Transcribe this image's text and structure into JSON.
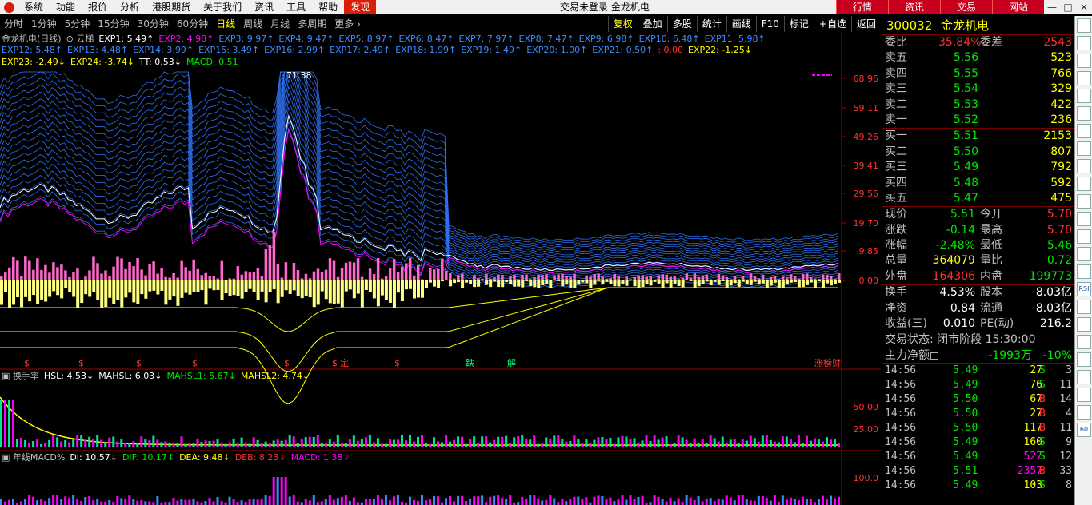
{
  "menubar": {
    "items": [
      "系统",
      "功能",
      "报价",
      "分析",
      "港股期货",
      "关于我们",
      "资讯",
      "工具",
      "帮助",
      "发现"
    ],
    "active_index": 9,
    "center_text": "交易未登录  金龙机电",
    "right_buttons": [
      "行情",
      "资讯",
      "交易",
      "网站"
    ],
    "window_controls": [
      "—",
      "□",
      "✕"
    ]
  },
  "periodbar": {
    "periods": [
      "分时",
      "1分钟",
      "5分钟",
      "15分钟",
      "30分钟",
      "60分钟",
      "日线",
      "周线",
      "月线",
      "多周期",
      "更多 ›"
    ],
    "active_index": 6,
    "right_buttons": [
      "复权",
      "叠加",
      "多股",
      "统计",
      "画线",
      "F10",
      "标记",
      "+自选",
      "返回"
    ],
    "right_highlight_index": 0
  },
  "main_indicator": {
    "name": "金龙机电(日线)",
    "cloud_label": "云梯",
    "items": [
      {
        "t": "EXP1: 5.49↑",
        "c": "#ffffff"
      },
      {
        "t": "EXP2: 4.98↑",
        "c": "#ff00ff"
      },
      {
        "t": "EXP3: 9.97↑",
        "c": "#3e8cff"
      },
      {
        "t": "EXP4: 9.47↑",
        "c": "#3e8cff"
      },
      {
        "t": "EXP5: 8.97↑",
        "c": "#3e8cff"
      },
      {
        "t": "EXP6: 8.47↑",
        "c": "#3e8cff"
      },
      {
        "t": "EXP7: 7.97↑",
        "c": "#3e8cff"
      },
      {
        "t": "EXP8: 7.47↑",
        "c": "#3e8cff"
      },
      {
        "t": "EXP9: 6.98↑",
        "c": "#3e8cff"
      },
      {
        "t": "EXP10: 6.48↑",
        "c": "#3e8cff"
      },
      {
        "t": "EXP11: 5.98↑",
        "c": "#3e8cff"
      }
    ],
    "items_line2": [
      {
        "t": "EXP12: 5.48↑",
        "c": "#3e8cff"
      },
      {
        "t": "EXP13: 4.48↑",
        "c": "#3e8cff"
      },
      {
        "t": "EXP14: 3.99↑",
        "c": "#3e8cff"
      },
      {
        "t": "EXP15: 3.49↑",
        "c": "#3e8cff"
      },
      {
        "t": "EXP16: 2.99↑",
        "c": "#3e8cff"
      },
      {
        "t": "EXP17: 2.49↑",
        "c": "#3e8cff"
      },
      {
        "t": "EXP18: 1.99↑",
        "c": "#3e8cff"
      },
      {
        "t": "EXP19: 1.49↑",
        "c": "#3e8cff"
      },
      {
        "t": "EXP20: 1.00↑",
        "c": "#3e8cff"
      },
      {
        "t": "EXP21: 0.50↑",
        "c": "#3e8cff"
      },
      {
        "t": ": 0.00",
        "c": "#ff3232"
      },
      {
        "t": "EXP22: -1.25↓",
        "c": "#ffff00"
      }
    ],
    "items_line3": [
      {
        "t": "EXP23: -2.49↓",
        "c": "#ffff00"
      },
      {
        "t": "EXP24: -3.74↓",
        "c": "#ffff00"
      },
      {
        "t": "TT: 0.53↓",
        "c": "#ffffff"
      },
      {
        "t": "MACD: 0.51",
        "c": "#00e600"
      }
    ],
    "y_ticks": [
      "68.96",
      "59.11",
      "49.26",
      "39.41",
      "29.56",
      "19.70",
      "9.85",
      "0.00"
    ],
    "peak_label": "71.38",
    "markers": [
      "$",
      "$",
      "$",
      "$",
      "$",
      "$",
      "定",
      "$",
      "跌",
      "解",
      "涨榜财"
    ]
  },
  "turnover_indicator": {
    "name": "换手率",
    "items": [
      {
        "t": "HSL: 4.53↓",
        "c": "#ffffff"
      },
      {
        "t": "MAHSL: 6.03↓",
        "c": "#ffffff"
      },
      {
        "t": "MAHSL1: 5.67↓",
        "c": "#00e600"
      },
      {
        "t": "MAHSL2: 4.74↓",
        "c": "#ffff00"
      }
    ],
    "y_ticks": [
      "50.00",
      "25.00"
    ]
  },
  "macd_indicator": {
    "name": "年线MACD%",
    "items": [
      {
        "t": "DI: 10.57↓",
        "c": "#ffffff"
      },
      {
        "t": "DIF: 10.17↓",
        "c": "#00e600"
      },
      {
        "t": "DEA: 9.48↓",
        "c": "#ffff00"
      },
      {
        "t": "DEB: 8.23↓",
        "c": "#ff3232"
      },
      {
        "t": "MACD: 1.38↓",
        "c": "#ff00ff"
      }
    ],
    "y_ticks": [
      "100.0"
    ]
  },
  "quote": {
    "code": "300032",
    "name": "金龙机电",
    "weibi_label": "委比",
    "weibi": "35.84%",
    "weicha_label": "委差",
    "weicha": "2543",
    "asks": [
      {
        "label": "卖五",
        "price": "5.56",
        "vol": "523"
      },
      {
        "label": "卖四",
        "price": "5.55",
        "vol": "766"
      },
      {
        "label": "卖三",
        "price": "5.54",
        "vol": "329"
      },
      {
        "label": "卖二",
        "price": "5.53",
        "vol": "422"
      },
      {
        "label": "卖一",
        "price": "5.52",
        "vol": "236"
      }
    ],
    "bids": [
      {
        "label": "买一",
        "price": "5.51",
        "vol": "2153"
      },
      {
        "label": "买二",
        "price": "5.50",
        "vol": "807"
      },
      {
        "label": "买三",
        "price": "5.49",
        "vol": "792"
      },
      {
        "label": "买四",
        "price": "5.48",
        "vol": "592"
      },
      {
        "label": "买五",
        "price": "5.47",
        "vol": "475"
      }
    ],
    "stats": [
      {
        "l1": "现价",
        "v1": "5.51",
        "c1": "#00e600",
        "l2": "今开",
        "v2": "5.70",
        "c2": "#ff3232"
      },
      {
        "l1": "涨跌",
        "v1": "-0.14",
        "c1": "#00e600",
        "l2": "最高",
        "v2": "5.70",
        "c2": "#ff3232"
      },
      {
        "l1": "涨幅",
        "v1": "-2.48%",
        "c1": "#00e600",
        "l2": "最低",
        "v2": "5.46",
        "c2": "#00e600"
      },
      {
        "l1": "总量",
        "v1": "364079",
        "c1": "#ffff00",
        "l2": "量比",
        "v2": "0.72",
        "c2": "#00e600"
      },
      {
        "l1": "外盘",
        "v1": "164306",
        "c1": "#ff3232",
        "l2": "内盘",
        "v2": "199773",
        "c2": "#00e600"
      }
    ],
    "info": [
      {
        "l1": "换手",
        "v1": "4.53%",
        "l2": "股本",
        "v2": "8.03亿"
      },
      {
        "l1": "净资",
        "v1": "0.84",
        "l2": "流通",
        "v2": "8.03亿"
      },
      {
        "l1": "收益(三)",
        "v1": "0.010",
        "l2": "PE(动)",
        "v2": "216.2"
      }
    ],
    "trade_status": "交易状态: 闭市阶段 15:30:00",
    "main_flow_label": "主力净额",
    "main_flow_value": "-1993万",
    "main_flow_pct": "-10%",
    "ticks": [
      {
        "t": "14:56",
        "p": "5.49",
        "pc": "#00e600",
        "v": "27",
        "vc": "#ffff00",
        "d": "S",
        "dc": "#00e600",
        "n": "3"
      },
      {
        "t": "14:56",
        "p": "5.49",
        "pc": "#00e600",
        "v": "76",
        "vc": "#ffff00",
        "d": "S",
        "dc": "#00e600",
        "n": "11"
      },
      {
        "t": "14:56",
        "p": "5.50",
        "pc": "#00e600",
        "v": "67",
        "vc": "#ffff00",
        "d": "B",
        "dc": "#ff3232",
        "n": "14"
      },
      {
        "t": "14:56",
        "p": "5.50",
        "pc": "#00e600",
        "v": "27",
        "vc": "#ffff00",
        "d": "B",
        "dc": "#ff3232",
        "n": "4"
      },
      {
        "t": "14:56",
        "p": "5.50",
        "pc": "#00e600",
        "v": "117",
        "vc": "#ffff00",
        "d": "B",
        "dc": "#ff3232",
        "n": "11"
      },
      {
        "t": "14:56",
        "p": "5.49",
        "pc": "#00e600",
        "v": "160",
        "vc": "#ffff00",
        "d": "S",
        "dc": "#00e600",
        "n": "9"
      },
      {
        "t": "14:56",
        "p": "5.49",
        "pc": "#00e600",
        "v": "527",
        "vc": "#ff00ff",
        "d": "S",
        "dc": "#00e600",
        "n": "12"
      },
      {
        "t": "14:56",
        "p": "5.51",
        "pc": "#00e600",
        "v": "2357",
        "vc": "#ff00ff",
        "d": "B",
        "dc": "#ff3232",
        "n": "33"
      },
      {
        "t": "14:56",
        "p": "5.49",
        "pc": "#00e600",
        "v": "103",
        "vc": "#ffff00",
        "d": "S",
        "dc": "#00e600",
        "n": "8"
      }
    ]
  },
  "sidetool": [
    "icon-1",
    "icon-2",
    "icon-3",
    "icon-4",
    "icon-5",
    "icon-6",
    "icon-7",
    "icon-8",
    "icon-9",
    "icon-10",
    "icon-11",
    "icon-12",
    "icon-13",
    "icon-14",
    "icon-15",
    "RSI",
    "icon-17",
    "icon-18",
    "icon-19",
    "icon-20",
    "icon-21",
    "icon-22",
    "icon-23",
    "60"
  ]
}
